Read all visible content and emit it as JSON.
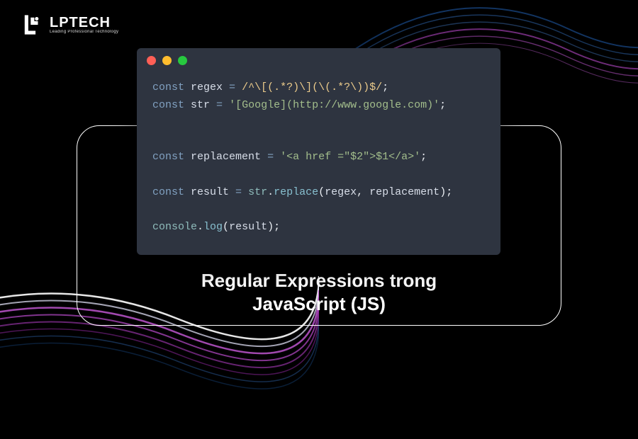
{
  "logo": {
    "main": "LPTECH",
    "sub": "Leading Professional Technology"
  },
  "title": {
    "line1": "Regular Expressions trong",
    "line2": "JavaScript (JS)"
  },
  "code": {
    "kw_const": "const",
    "var_regex": "regex",
    "eq": " = ",
    "regex_literal": "/^\\[(.*?)\\](\\(.*?\\))$/",
    "semi": ";",
    "var_str": "str",
    "str_literal": "'[Google](http://www.google.com)'",
    "var_replacement": "replacement",
    "replacement_literal": "'<a href =\"$2\">$1</a>'",
    "var_result": "result",
    "dot_replace": ".",
    "fn_replace": "replace",
    "open_paren": "(",
    "close_paren": ")",
    "comma": ", ",
    "obj_console": "console",
    "fn_log": "log",
    "obj_str": "str"
  },
  "window_controls": {
    "close": "close",
    "minimize": "minimize",
    "maximize": "maximize"
  }
}
